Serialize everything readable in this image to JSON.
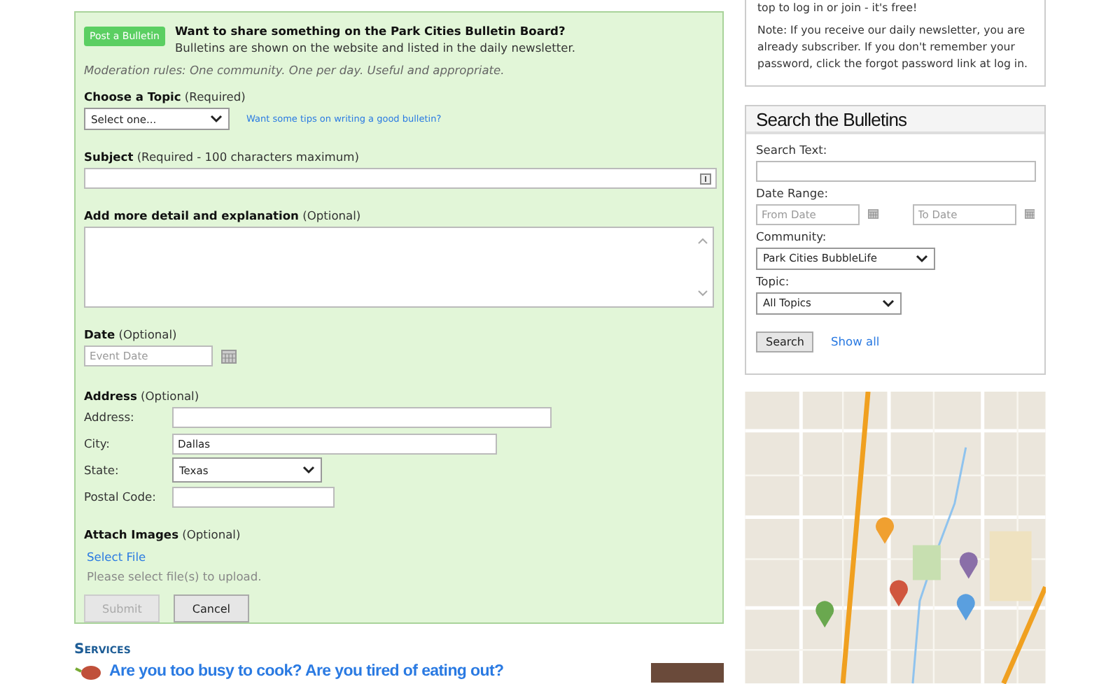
{
  "bulletin_form": {
    "post_badge": "Post a Bulletin",
    "heading": "Want to share something on the Park Cities Bulletin Board?",
    "subheading": "Bulletins are shown on the website and listed in the daily newsletter.",
    "moderation": "Moderation rules: One community. One per day. Useful and appropriate.",
    "topic": {
      "label": "Choose a Topic",
      "hint": "(Required)",
      "value": "Select one...",
      "tips_link": "Want some tips on writing a good bulletin?"
    },
    "subject": {
      "label": "Subject",
      "hint": "(Required - 100 characters maximum)"
    },
    "detail": {
      "label": "Add more detail and explanation",
      "hint": "(Optional)"
    },
    "date": {
      "label": "Date",
      "hint": "(Optional)",
      "placeholder": "Event Date"
    },
    "address": {
      "label": "Address",
      "hint": "(Optional)",
      "fields": [
        {
          "kind": "text",
          "label": "Address:"
        },
        {
          "kind": "text",
          "label": "City:",
          "value": "Dallas"
        },
        {
          "kind": "select",
          "label": "State:",
          "value": "Texas"
        },
        {
          "kind": "text",
          "label": "Postal Code:"
        }
      ]
    },
    "attach": {
      "label": "Attach Images",
      "hint": "(Optional)",
      "link": "Select File",
      "note": "Please select file(s) to upload."
    },
    "buttons": [
      {
        "label": "Submit",
        "disabled": true
      },
      {
        "label": "Cancel",
        "disabled": false
      }
    ]
  },
  "services": {
    "title": "Services",
    "headline": "Are you too busy to cook? Are you tired of eating out?"
  },
  "login_note": {
    "cut_line": "top to log in or join - it's free!",
    "note": "Note: If you receive our daily newsletter, you are already subscriber. If you don't remember your password, click the forgot password link at log in."
  },
  "search": {
    "title": "Search the Bulletins",
    "text_label": "Search Text:",
    "range_label": "Date Range:",
    "from_placeholder": "From Date",
    "to_placeholder": "To Date",
    "community_label": "Community:",
    "community_value": "Park Cities BubbleLife",
    "topic_label": "Topic:",
    "topic_value": "All Topics",
    "search_button": "Search",
    "show_all": "Show all"
  }
}
